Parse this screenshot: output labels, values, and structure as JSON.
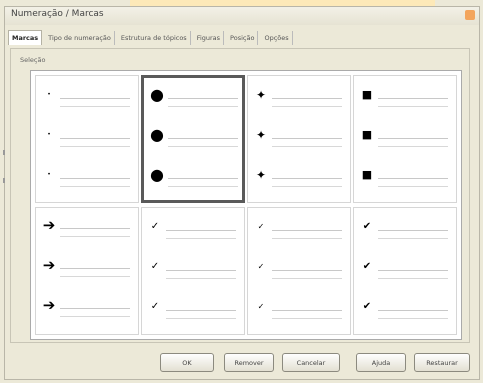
{
  "window": {
    "title": "Numeração / Marcas"
  },
  "tabs": [
    {
      "label": "Marcas",
      "active": true
    },
    {
      "label": "Tipo de numeração",
      "active": false
    },
    {
      "label": "Estrutura de tópicos",
      "active": false
    },
    {
      "label": "Figuras",
      "active": false
    },
    {
      "label": "Posição",
      "active": false
    },
    {
      "label": "Opções",
      "active": false
    }
  ],
  "section_label": "Seleção",
  "bullet_styles": [
    {
      "icon": "small-dot",
      "glyph": "•",
      "selected": false
    },
    {
      "icon": "large-dot",
      "glyph": "●",
      "selected": true
    },
    {
      "icon": "star",
      "glyph": "✦",
      "selected": false
    },
    {
      "icon": "square",
      "glyph": "■",
      "selected": false
    },
    {
      "icon": "arrow",
      "glyph": "➔",
      "selected": false
    },
    {
      "icon": "checkmark",
      "glyph": "✓",
      "selected": false
    },
    {
      "icon": "tick",
      "glyph": "✓",
      "selected": false
    },
    {
      "icon": "check-bold",
      "glyph": "✔",
      "selected": false
    }
  ],
  "buttons": {
    "ok": "OK",
    "remove": "Remover",
    "cancel": "Cancelar",
    "help": "Ajuda",
    "reset": "Restaurar"
  },
  "colors": {
    "dialog_background": "#ece9d8",
    "close_button": "#f3a55d",
    "banner": "#fde9b8"
  }
}
